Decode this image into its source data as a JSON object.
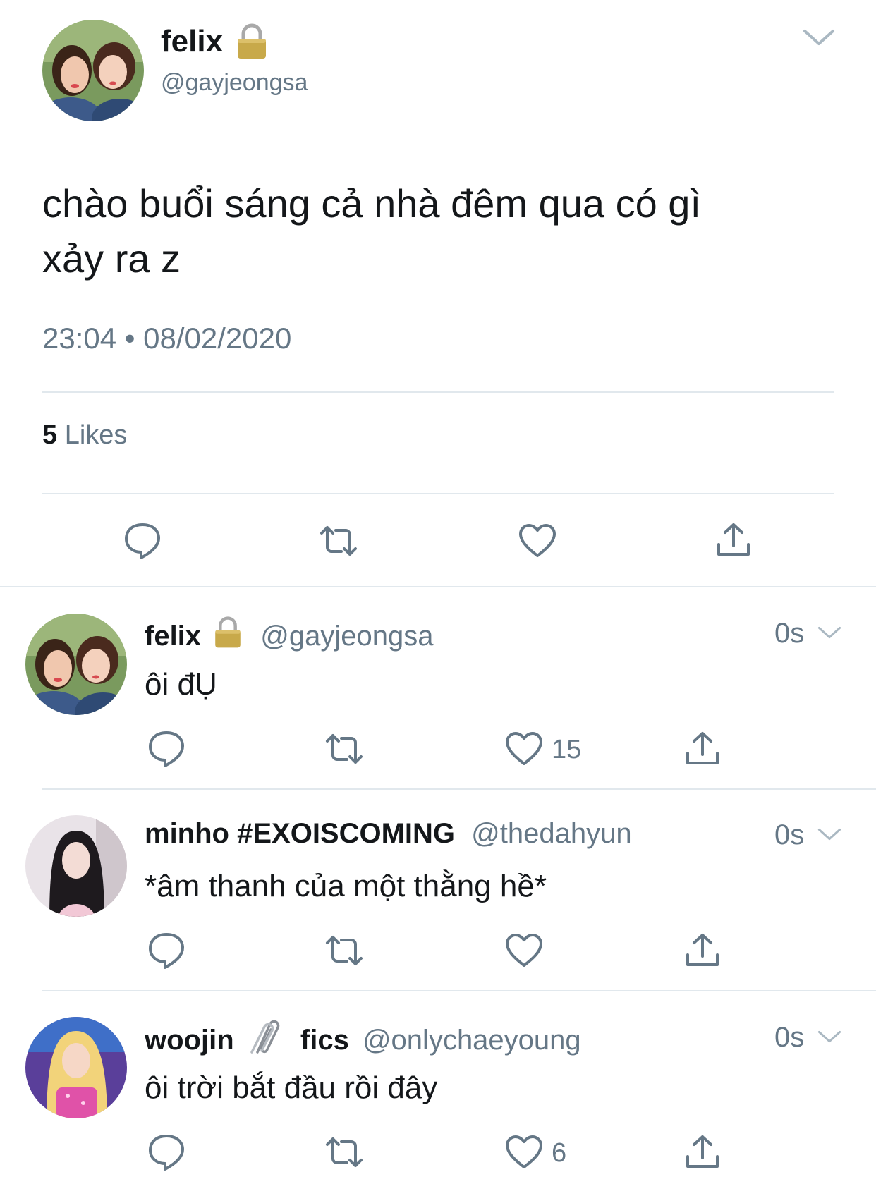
{
  "main_tweet": {
    "display_name": "felix",
    "handle": "@gayjeongsa",
    "text_line1": "chào buổi sáng cả nhà đêm qua có gì",
    "text_line2": "xảy ra z",
    "timestamp": "23:04 • 08/02/2020",
    "likes_count": "5",
    "likes_label": "Likes"
  },
  "replies": [
    {
      "display_name": "felix",
      "handle": "@gayjeongsa",
      "time": "0s",
      "text": "ôi đỤ",
      "like_count": "15"
    },
    {
      "display_name": "minho #EXOISCOMING",
      "handle": "@thedahyun",
      "time": "0s",
      "text": "*âm thanh của một thằng hề*",
      "like_count": ""
    },
    {
      "display_name": "woojin",
      "display_name_suffix": "fics",
      "handle": "@onlychaeyoung",
      "time": "0s",
      "text": "ôi trời bắt đầu rồi đây",
      "like_count": "6"
    }
  ],
  "icons": [
    "lock-icon",
    "chevron-down-icon",
    "reply-icon",
    "retweet-icon",
    "heart-icon",
    "share-icon",
    "paperclip-icon"
  ],
  "colors": {
    "text": "#14171a",
    "muted": "#657786",
    "divider": "#e1e8ed",
    "lock": "#c8a94a"
  }
}
